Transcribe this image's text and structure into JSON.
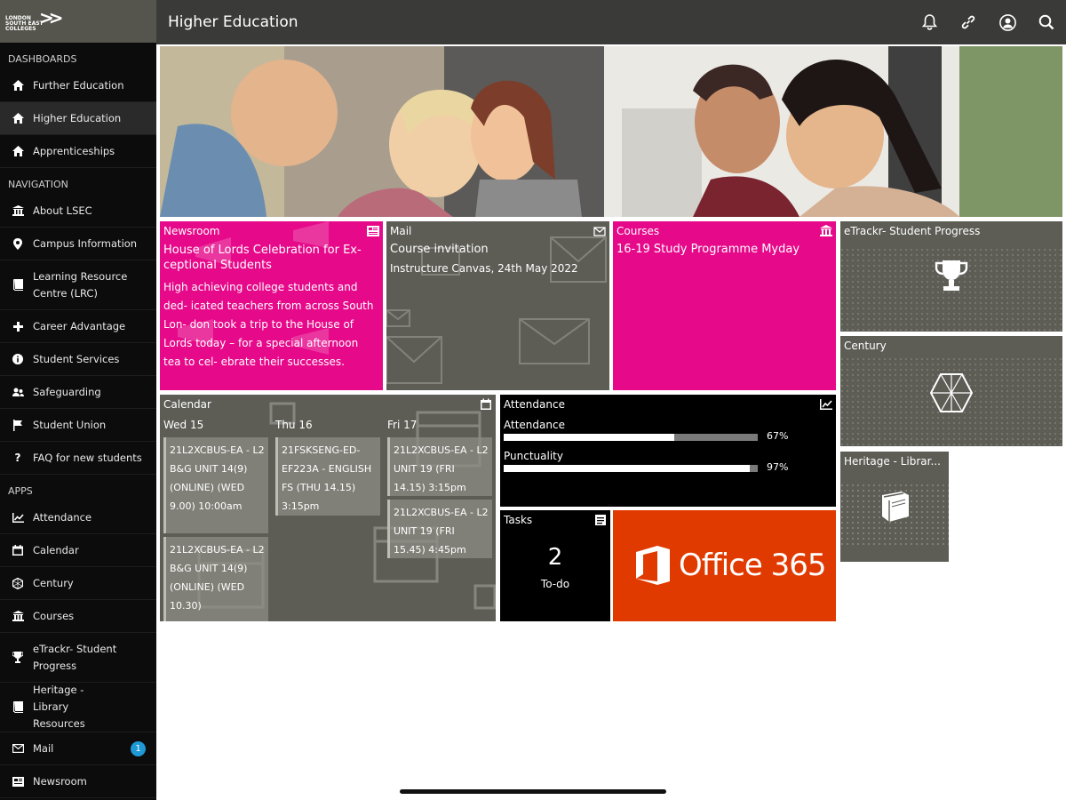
{
  "colors": {
    "sidebar_bg": "#0c0c0c",
    "topbar_bg": "#3a3a38",
    "tile_gray": "#5d5d56",
    "tile_pink": "#e6098a",
    "tile_black": "#000000",
    "office_orange": "#e03a00",
    "badge_blue": "#1f98d6"
  },
  "brand": {
    "logo_lines": [
      "LONDON",
      "SOUTH EAST",
      "COLLEGES"
    ]
  },
  "sidebar": {
    "dashboards_heading": "DASHBOARDS",
    "dashboards": [
      {
        "label": "Further Education",
        "icon": "home-icon"
      },
      {
        "label": "Higher Education",
        "icon": "home-icon",
        "active": true
      },
      {
        "label": "Apprenticeships",
        "icon": "home-icon"
      }
    ],
    "navigation_heading": "NAVIGATION",
    "navigation": [
      {
        "label": "About LSEC",
        "icon": "institution-icon"
      },
      {
        "label": "Campus Information",
        "icon": "map-pin-icon"
      },
      {
        "label": "Learning Resource Centre (LRC)",
        "icon": "book-icon"
      },
      {
        "label": "Career Advantage",
        "icon": "plus-icon"
      },
      {
        "label": "Student Services",
        "icon": "info-icon"
      },
      {
        "label": "Safeguarding",
        "icon": "people-icon"
      },
      {
        "label": "Student Union",
        "icon": "flag-icon"
      },
      {
        "label": "FAQ for new students",
        "icon": "question-icon"
      }
    ],
    "apps_heading": "APPS",
    "apps": [
      {
        "label": "Attendance",
        "icon": "chart-icon"
      },
      {
        "label": "Calendar",
        "icon": "calendar-icon"
      },
      {
        "label": "Century",
        "icon": "hexagon-icon"
      },
      {
        "label": "Courses",
        "icon": "institution-icon"
      },
      {
        "label": "eTrackr- Student Progress",
        "icon": "trophy-icon"
      },
      {
        "label": "Heritage - Library Resources",
        "icon": "book-icon"
      },
      {
        "label": "Mail",
        "icon": "mail-icon",
        "badge": "1"
      },
      {
        "label": "Newsroom",
        "icon": "newspaper-icon"
      }
    ]
  },
  "header": {
    "title": "Higher Education",
    "icons": [
      "bell-icon",
      "link-icon",
      "user-icon",
      "search-icon"
    ]
  },
  "tiles": {
    "newsroom": {
      "title": "Newsroom",
      "headline": "House of Lords Celebration for Ex- ceptional Students",
      "body": "High achieving college students and ded- icated teachers from across South Lon- don took a trip to the House of Lords today – for a special afternoon tea to cel- ebrate their successes."
    },
    "mail": {
      "title": "Mail",
      "subject": "Course invitation",
      "subtitle": "Instructure Canvas, 24th May 2022"
    },
    "courses": {
      "title": "Courses",
      "course": "16-19 Study Programme Myday"
    },
    "etrackr": {
      "title": "eTrackr- Student Progress"
    },
    "century": {
      "title": "Century"
    },
    "heritage": {
      "title": "Heritage - Librar..."
    },
    "calendar": {
      "title": "Calendar",
      "days": [
        {
          "label": "Wed 15",
          "events": [
            "21L2XCBUS-EA - L2 B&G UNIT 14(9) (ONLINE) (WED 9.00) 10:00am",
            "21L2XCBUS-EA - L2 B&G UNIT 14(9) (ONLINE) (WED 10.30)"
          ]
        },
        {
          "label": "Thu 16",
          "events": [
            "21FSKSENG-ED-EF223A - ENGLISH FS (THU 14.15) 3:15pm"
          ]
        },
        {
          "label": "Fri 17",
          "events": [
            "21L2XCBUS-EA - L2 UNIT 19 (FRI 14.15) 3:15pm",
            "21L2XCBUS-EA - L2 UNIT 19 (FRI 15.45) 4:45pm"
          ]
        }
      ]
    },
    "attendance": {
      "title": "Attendance",
      "metrics": [
        {
          "label": "Attendance",
          "value": "67%",
          "fraction": 0.67
        },
        {
          "label": "Punctuality",
          "value": "97%",
          "fraction": 0.97
        }
      ]
    },
    "tasks": {
      "title": "Tasks",
      "count": "2",
      "label": "To-do"
    },
    "office": {
      "label": "Office 365"
    }
  }
}
